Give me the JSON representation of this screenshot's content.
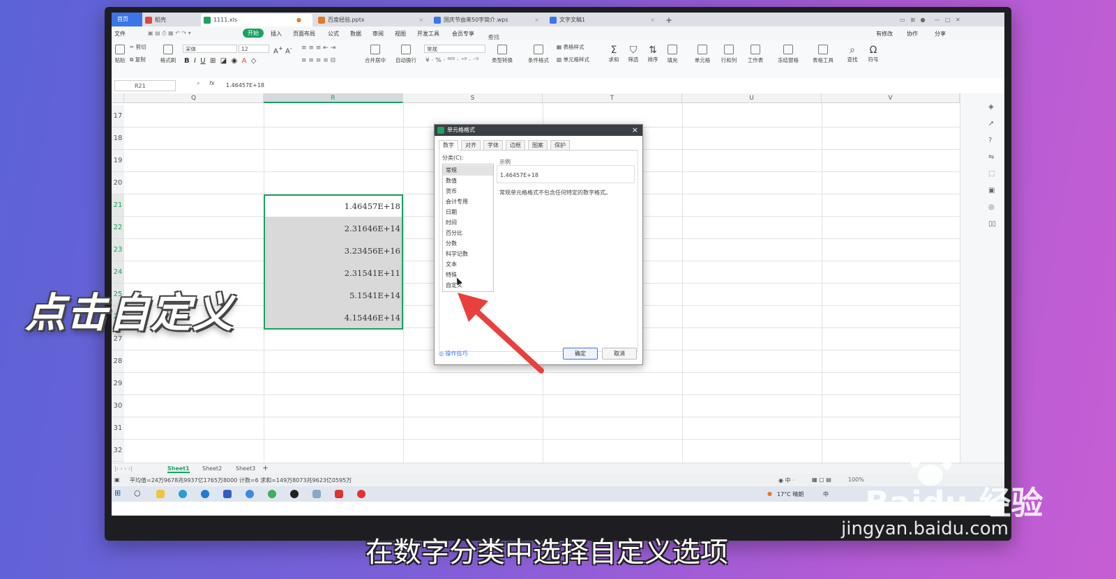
{
  "tabs": [
    {
      "label": "首页"
    },
    {
      "label": "稻壳"
    },
    {
      "label": "1111.xls"
    },
    {
      "label": "百度经验.pptx"
    },
    {
      "label": "国庆节由来50字简介.wps"
    },
    {
      "label": "文字文稿1"
    }
  ],
  "menu": [
    "文件",
    "开始",
    "插入",
    "页面布局",
    "公式",
    "数据",
    "审阅",
    "视图",
    "开发工具",
    "会员专享"
  ],
  "menu_search": "查找命令、搜索模板",
  "menu_right": [
    "有修改",
    "协作",
    "分享"
  ],
  "ribbon": {
    "cut": "剪切",
    "copy": "复制",
    "paste": "粘贴",
    "format_painter": "格式刷",
    "font": "宋体",
    "size": "12",
    "merge": "合并居中",
    "wrap": "自动换行",
    "numfmt": "常规",
    "type_convert": "类型转换",
    "cond_fmt": "条件格式",
    "table_style": "表格样式",
    "cell_style": "单元格样式",
    "sum": "求和",
    "filter": "筛选",
    "sort": "排序",
    "fill": "填充",
    "cell": "单元格",
    "rowcol": "行和列",
    "sheet": "工作表",
    "freeze": "冻结窗格",
    "table_tools": "表格工具",
    "find": "查找",
    "symbol": "符号"
  },
  "formula_bar": {
    "name_box": "R21",
    "fx": "fx",
    "value": "1.46457E+18"
  },
  "columns": [
    "Q",
    "R",
    "S",
    "T",
    "U",
    "V"
  ],
  "rows": [
    "17",
    "18",
    "19",
    "20",
    "21",
    "22",
    "23",
    "24",
    "25",
    "26",
    "27",
    "28",
    "29",
    "30",
    "31",
    "32"
  ],
  "cells": [
    "1.46457E+18",
    "2.31646E+14",
    "3.23456E+16",
    "2.31541E+11",
    "5.1541E+14",
    "4.15446E+14"
  ],
  "sheets": [
    "Sheet1",
    "Sheet2",
    "Sheet3"
  ],
  "status": {
    "summary": "平均值=24万9678兆9937亿1765万8000  计数=6  求和=149万8073兆9623亿0595万",
    "zoom": "100%"
  },
  "taskbar": {
    "weather": "17°C 晴朗",
    "ime": "中"
  },
  "dialog": {
    "title": "单元格格式",
    "tabs": [
      "数字",
      "对齐",
      "字体",
      "边框",
      "图案",
      "保护"
    ],
    "category_label": "分类(C):",
    "categories": [
      "常规",
      "数值",
      "货币",
      "会计专用",
      "日期",
      "时间",
      "百分比",
      "分数",
      "科学记数",
      "文本",
      "特殊",
      "自定义"
    ],
    "sample_label": "示例",
    "sample_value": "1.46457E+18",
    "description": "常规单元格格式不包含任何特定的数字格式。",
    "tips": "操作技巧",
    "ok": "确定",
    "cancel": "取消"
  },
  "overlay": {
    "title": "点击自定义",
    "subtitle": "在数字分类中选择自定义选项",
    "watermark_brand": "Baidu 经验",
    "watermark_url": "jingyan.baidu.com"
  },
  "colors": {
    "accent_green": "#1aa260",
    "arrow_red": "#e8403a",
    "tab_blue": "#3b76e8"
  }
}
